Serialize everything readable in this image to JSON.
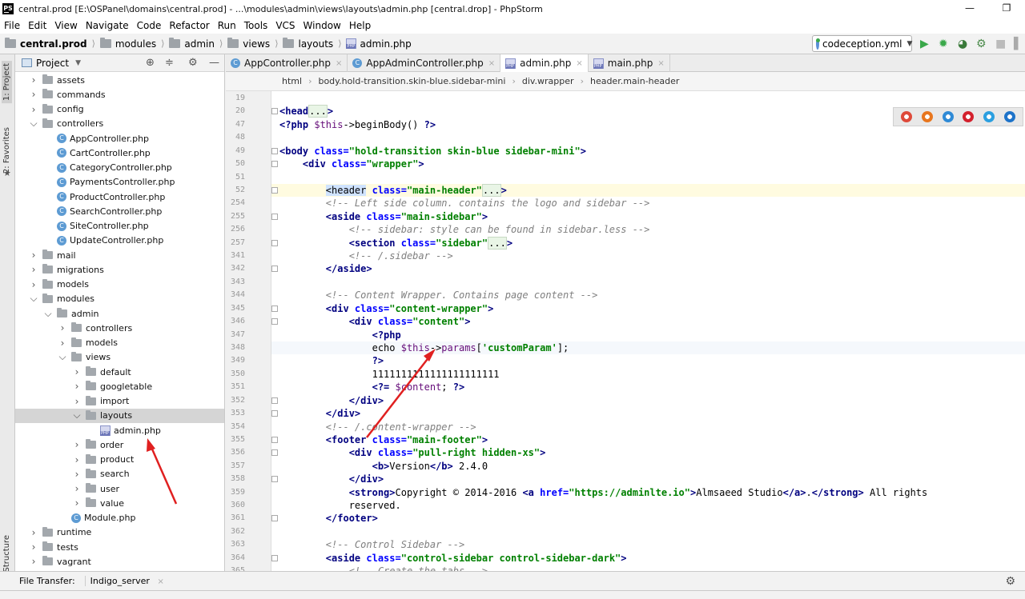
{
  "window": {
    "title": "central.prod [E:\\OSPanel\\domains\\central.prod] - ...\\modules\\admin\\views\\layouts\\admin.php [central.drop] - PhpStorm",
    "logo": "PS",
    "min": "—",
    "max": "❐"
  },
  "menu": [
    "File",
    "Edit",
    "View",
    "Navigate",
    "Code",
    "Refactor",
    "Run",
    "Tools",
    "VCS",
    "Window",
    "Help"
  ],
  "breadcrumb_nav": [
    "central.prod",
    "modules",
    "admin",
    "views",
    "layouts",
    "admin.php"
  ],
  "run_config": "codeception.yml",
  "toolbar_icons": {
    "run": "▶",
    "debug": "✹",
    "coverage": "◕",
    "profile": "⚙",
    "stop": "■",
    "more": "▌"
  },
  "left_strip": {
    "project": "1: Project",
    "favorites": "2: Favorites",
    "structure": "Z: Structure"
  },
  "project_panel": {
    "title": "Project",
    "dropdown": "▼",
    "locate": "⊕",
    "collapse": "≑",
    "settings": "⚙",
    "hide": "—"
  },
  "tree": [
    {
      "label": "assets",
      "type": "folder",
      "indent": 0,
      "arrow": "›"
    },
    {
      "label": "commands",
      "type": "folder",
      "indent": 0,
      "arrow": "›"
    },
    {
      "label": "config",
      "type": "folder",
      "indent": 0,
      "arrow": "›"
    },
    {
      "label": "controllers",
      "type": "folder",
      "indent": 0,
      "arrow": "⌄"
    },
    {
      "label": "AppController.php",
      "type": "class",
      "indent": 1
    },
    {
      "label": "CartController.php",
      "type": "class",
      "indent": 1
    },
    {
      "label": "CategoryController.php",
      "type": "class",
      "indent": 1
    },
    {
      "label": "PaymentsController.php",
      "type": "class",
      "indent": 1
    },
    {
      "label": "ProductController.php",
      "type": "class",
      "indent": 1
    },
    {
      "label": "SearchController.php",
      "type": "class",
      "indent": 1
    },
    {
      "label": "SiteController.php",
      "type": "class",
      "indent": 1
    },
    {
      "label": "UpdateController.php",
      "type": "class",
      "indent": 1
    },
    {
      "label": "mail",
      "type": "folder",
      "indent": 0,
      "arrow": "›"
    },
    {
      "label": "migrations",
      "type": "folder",
      "indent": 0,
      "arrow": "›"
    },
    {
      "label": "models",
      "type": "folder",
      "indent": 0,
      "arrow": "›"
    },
    {
      "label": "modules",
      "type": "folder",
      "indent": 0,
      "arrow": "⌄"
    },
    {
      "label": "admin",
      "type": "folder",
      "indent": 1,
      "arrow": "⌄"
    },
    {
      "label": "controllers",
      "type": "folder",
      "indent": 2,
      "arrow": "›"
    },
    {
      "label": "models",
      "type": "folder",
      "indent": 2,
      "arrow": "›"
    },
    {
      "label": "views",
      "type": "folder",
      "indent": 2,
      "arrow": "⌄"
    },
    {
      "label": "default",
      "type": "folder",
      "indent": 3,
      "arrow": "›"
    },
    {
      "label": "googletable",
      "type": "folder",
      "indent": 3,
      "arrow": "›"
    },
    {
      "label": "import",
      "type": "folder",
      "indent": 3,
      "arrow": "›"
    },
    {
      "label": "layouts",
      "type": "folder",
      "indent": 3,
      "arrow": "⌄",
      "selected": true
    },
    {
      "label": "admin.php",
      "type": "php",
      "indent": 4
    },
    {
      "label": "order",
      "type": "folder",
      "indent": 3,
      "arrow": "›"
    },
    {
      "label": "product",
      "type": "folder",
      "indent": 3,
      "arrow": "›"
    },
    {
      "label": "search",
      "type": "folder",
      "indent": 3,
      "arrow": "›"
    },
    {
      "label": "user",
      "type": "folder",
      "indent": 3,
      "arrow": "›"
    },
    {
      "label": "value",
      "type": "folder",
      "indent": 3,
      "arrow": "›"
    },
    {
      "label": "Module.php",
      "type": "class",
      "indent": 2
    },
    {
      "label": "runtime",
      "type": "folder",
      "indent": 0,
      "arrow": "›"
    },
    {
      "label": "tests",
      "type": "folder",
      "indent": 0,
      "arrow": "›"
    },
    {
      "label": "vagrant",
      "type": "folder",
      "indent": 0,
      "arrow": "›"
    }
  ],
  "tabs": [
    {
      "label": "AppController.php",
      "icon": "class",
      "active": false
    },
    {
      "label": "AppAdminController.php",
      "icon": "class",
      "active": false
    },
    {
      "label": "admin.php",
      "icon": "php",
      "active": true
    },
    {
      "label": "main.php",
      "icon": "php",
      "active": false
    }
  ],
  "tab_close": "×",
  "editor_breadcrumb": [
    "html",
    "body.hold-transition.skin-blue.sidebar-mini",
    "div.wrapper",
    "header.main-header"
  ],
  "code_lines": [
    {
      "n": "19",
      "segs": []
    },
    {
      "n": "20",
      "segs": [
        [
          "tg",
          "<head"
        ],
        [
          "fd",
          "..."
        ],
        [
          "tg",
          ">"
        ]
      ]
    },
    {
      "n": "47",
      "segs": [
        [
          "ph",
          "<?php "
        ],
        [
          "pv",
          "$this"
        ],
        [
          "pf",
          "->beginBody() "
        ],
        [
          "ph",
          "?>"
        ]
      ]
    },
    {
      "n": "48",
      "segs": []
    },
    {
      "n": "49",
      "segs": [
        [
          "tg",
          "<body "
        ],
        [
          "at",
          "class="
        ],
        [
          "vl",
          "\"hold-transition skin-blue sidebar-mini\""
        ],
        [
          "tg",
          ">"
        ]
      ]
    },
    {
      "n": "50",
      "segs": [
        [
          "pf",
          "    "
        ],
        [
          "tg",
          "<div "
        ],
        [
          "at",
          "class="
        ],
        [
          "vl",
          "\"wrapper\""
        ],
        [
          "tg",
          ">"
        ]
      ]
    },
    {
      "n": "51",
      "segs": []
    },
    {
      "n": "52",
      "segs": [
        [
          "pf",
          "        "
        ],
        [
          "tgsel",
          "<header"
        ],
        [
          "pf",
          " "
        ],
        [
          "at",
          "class="
        ],
        [
          "vl",
          "\"main-header\""
        ],
        [
          "fd",
          "..."
        ],
        [
          "tg",
          ">"
        ]
      ]
    },
    {
      "n": "254",
      "segs": [
        [
          "pf",
          "        "
        ],
        [
          "cm",
          "<!-- Left side column. contains the logo and sidebar -->"
        ]
      ]
    },
    {
      "n": "255",
      "segs": [
        [
          "pf",
          "        "
        ],
        [
          "tg",
          "<aside "
        ],
        [
          "at",
          "class="
        ],
        [
          "vl",
          "\"main-sidebar\""
        ],
        [
          "tg",
          ">"
        ]
      ]
    },
    {
      "n": "256",
      "segs": [
        [
          "pf",
          "            "
        ],
        [
          "cm",
          "<!-- sidebar: style can be found in sidebar.less -->"
        ]
      ]
    },
    {
      "n": "257",
      "segs": [
        [
          "pf",
          "            "
        ],
        [
          "tg",
          "<section "
        ],
        [
          "at",
          "class="
        ],
        [
          "vl",
          "\"sidebar\""
        ],
        [
          "fd",
          "..."
        ],
        [
          "tg",
          ">"
        ]
      ]
    },
    {
      "n": "341",
      "segs": [
        [
          "pf",
          "            "
        ],
        [
          "cm",
          "<!-- /.sidebar -->"
        ]
      ]
    },
    {
      "n": "342",
      "segs": [
        [
          "pf",
          "        "
        ],
        [
          "tg",
          "</aside>"
        ]
      ]
    },
    {
      "n": "343",
      "segs": []
    },
    {
      "n": "344",
      "segs": [
        [
          "pf",
          "        "
        ],
        [
          "cm",
          "<!-- Content Wrapper. Contains page content -->"
        ]
      ]
    },
    {
      "n": "345",
      "segs": [
        [
          "pf",
          "        "
        ],
        [
          "tg",
          "<div "
        ],
        [
          "at",
          "class="
        ],
        [
          "vl",
          "\"content-wrapper\""
        ],
        [
          "tg",
          ">"
        ]
      ]
    },
    {
      "n": "346",
      "segs": [
        [
          "pf",
          "            "
        ],
        [
          "tg",
          "<div "
        ],
        [
          "at",
          "class="
        ],
        [
          "vl",
          "\"content\""
        ],
        [
          "tg",
          ">"
        ]
      ]
    },
    {
      "n": "347",
      "segs": [
        [
          "pf",
          "                "
        ],
        [
          "ph",
          "<?php"
        ]
      ]
    },
    {
      "n": "348",
      "segs": [
        [
          "pf",
          "                echo "
        ],
        [
          "pv",
          "$this"
        ],
        [
          "pf",
          "->"
        ],
        [
          "pv",
          "params"
        ],
        [
          "pf",
          "["
        ],
        [
          "vl",
          "'customParam'"
        ],
        [
          "pf",
          "];"
        ]
      ]
    },
    {
      "n": "349",
      "segs": [
        [
          "pf",
          "                "
        ],
        [
          "ph",
          "?>"
        ]
      ]
    },
    {
      "n": "350",
      "segs": [
        [
          "pf",
          "                1111111111111111111111"
        ]
      ]
    },
    {
      "n": "351",
      "segs": [
        [
          "pf",
          "                "
        ],
        [
          "ph",
          "<?= "
        ],
        [
          "pv",
          "$content"
        ],
        [
          "pf",
          "; "
        ],
        [
          "ph",
          "?>"
        ]
      ]
    },
    {
      "n": "352",
      "segs": [
        [
          "pf",
          "            "
        ],
        [
          "tg",
          "</div>"
        ]
      ]
    },
    {
      "n": "353",
      "segs": [
        [
          "pf",
          "        "
        ],
        [
          "tg",
          "</div>"
        ]
      ]
    },
    {
      "n": "354",
      "segs": [
        [
          "pf",
          "        "
        ],
        [
          "cm",
          "<!-- /.content-wrapper -->"
        ]
      ]
    },
    {
      "n": "355",
      "segs": [
        [
          "pf",
          "        "
        ],
        [
          "tg",
          "<footer "
        ],
        [
          "at",
          "class="
        ],
        [
          "vl",
          "\"main-footer\""
        ],
        [
          "tg",
          ">"
        ]
      ]
    },
    {
      "n": "356",
      "segs": [
        [
          "pf",
          "            "
        ],
        [
          "tg",
          "<div "
        ],
        [
          "at",
          "class="
        ],
        [
          "vl",
          "\"pull-right hidden-xs\""
        ],
        [
          "tg",
          ">"
        ]
      ]
    },
    {
      "n": "357",
      "segs": [
        [
          "pf",
          "                "
        ],
        [
          "tg",
          "<b>"
        ],
        [
          "pf",
          "Version"
        ],
        [
          "tg",
          "</b>"
        ],
        [
          "pf",
          " 2.4.0"
        ]
      ]
    },
    {
      "n": "358",
      "segs": [
        [
          "pf",
          "            "
        ],
        [
          "tg",
          "</div>"
        ]
      ]
    },
    {
      "n": "359",
      "segs": [
        [
          "pf",
          "            "
        ],
        [
          "tg",
          "<strong>"
        ],
        [
          "pf",
          "Copyright © 2014-2016 "
        ],
        [
          "tg",
          "<a "
        ],
        [
          "at",
          "href="
        ],
        [
          "vl",
          "\"https://adminlte.io\""
        ],
        [
          "tg",
          ">"
        ],
        [
          "pf",
          "Almsaeed Studio"
        ],
        [
          "tg",
          "</a>"
        ],
        [
          "pf",
          "."
        ],
        [
          "tg",
          "</strong>"
        ],
        [
          "pf",
          " All rights"
        ]
      ]
    },
    {
      "n": "360",
      "segs": [
        [
          "pf",
          "            reserved."
        ]
      ]
    },
    {
      "n": "361",
      "segs": [
        [
          "pf",
          "        "
        ],
        [
          "tg",
          "</footer>"
        ]
      ]
    },
    {
      "n": "362",
      "segs": []
    },
    {
      "n": "363",
      "segs": [
        [
          "pf",
          "        "
        ],
        [
          "cm",
          "<!-- Control Sidebar -->"
        ]
      ]
    },
    {
      "n": "364",
      "segs": [
        [
          "pf",
          "        "
        ],
        [
          "tg",
          "<aside "
        ],
        [
          "at",
          "class="
        ],
        [
          "vl",
          "\"control-sidebar control-sidebar-dark\""
        ],
        [
          "tg",
          ">"
        ]
      ]
    },
    {
      "n": "365",
      "segs": [
        [
          "pf",
          "            "
        ],
        [
          "cm",
          "<!-- Create the tabs -->"
        ]
      ]
    }
  ],
  "browser_icons": [
    {
      "name": "chrome",
      "color": "#de4a3a"
    },
    {
      "name": "firefox",
      "color": "#e8761e"
    },
    {
      "name": "safari",
      "color": "#2f8ad6"
    },
    {
      "name": "opera",
      "color": "#d3212d"
    },
    {
      "name": "ie",
      "color": "#2b9fe0"
    },
    {
      "name": "edge",
      "color": "#1d73c9"
    }
  ],
  "bottom": {
    "label": "File Transfer:",
    "tab": "Indigo_server",
    "close": "×",
    "gear": "⚙"
  },
  "colors": {
    "annotation_arrow": "#e02020"
  }
}
